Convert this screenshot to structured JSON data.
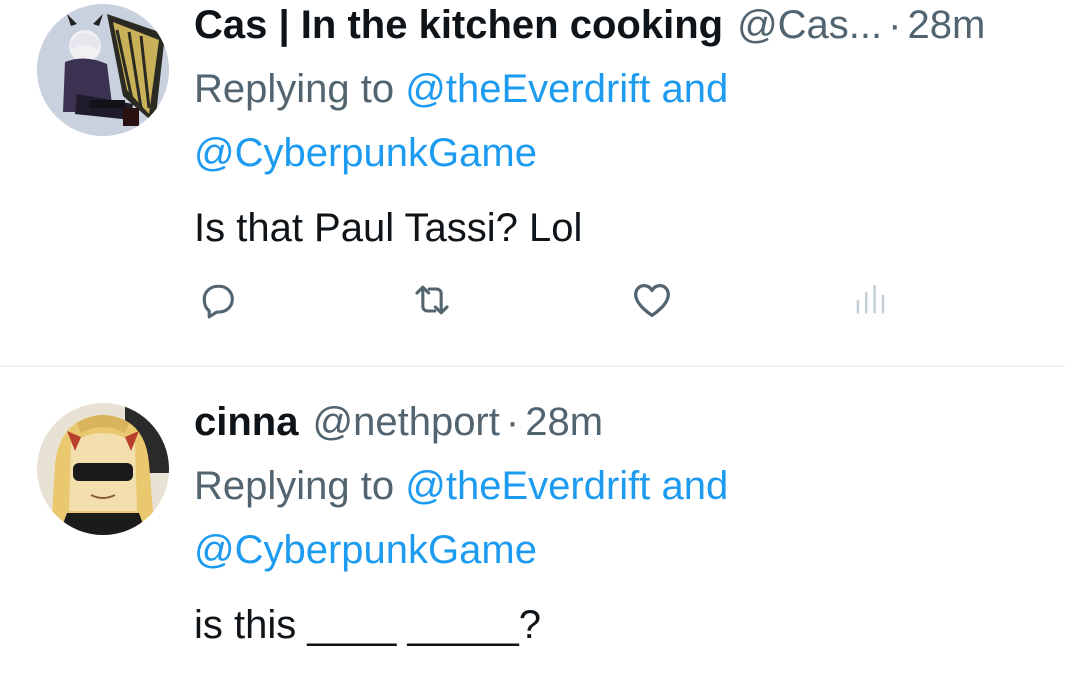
{
  "tweets": [
    {
      "display_name": "Cas | In the kitchen cooking",
      "handle": "@Cas...",
      "separator": "·",
      "time": "28m",
      "replying_prefix": "Replying to ",
      "replying_mention_1": "@theEverdrift",
      "replying_and": " and",
      "replying_mention_2": "@CyberpunkGame",
      "text": "Is that Paul Tassi? Lol",
      "actions": [
        "reply-icon",
        "retweet-icon",
        "like-icon",
        "views-icon"
      ]
    },
    {
      "display_name": "cinna",
      "handle": "@nethport",
      "separator": "·",
      "time": "28m",
      "replying_prefix": "Replying to ",
      "replying_mention_1": "@theEverdrift",
      "replying_and": " and",
      "replying_mention_2": "@CyberpunkGame",
      "text": "is this ____ _____?"
    }
  ],
  "colors": {
    "primary_text": "#0f1419",
    "secondary_text": "#536471",
    "link": "#1d9bf0",
    "divider": "#eff3f4"
  }
}
